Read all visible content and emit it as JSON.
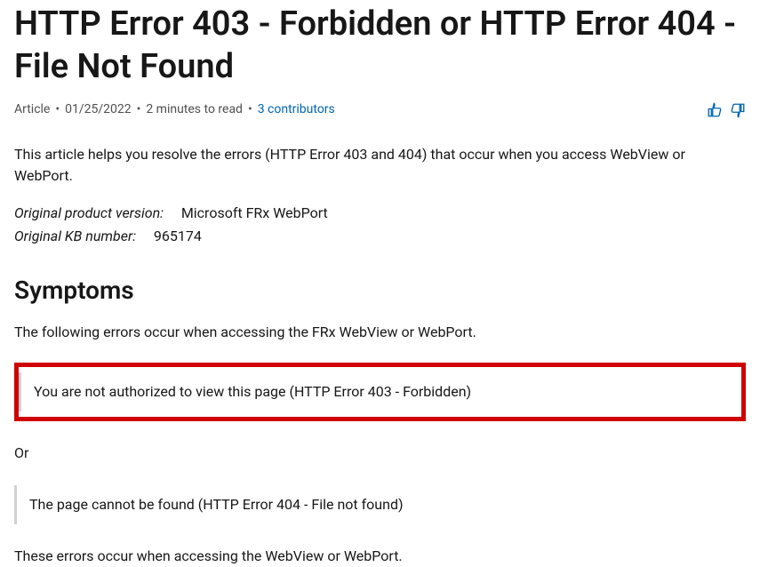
{
  "title": "HTTP Error 403 - Forbidden or HTTP Error 404 - File Not Found",
  "meta": {
    "type": "Article",
    "date": "01/25/2022",
    "reading_time": "2 minutes to read",
    "contributors": "3 contributors"
  },
  "intro": "This article helps you resolve the errors (HTTP Error 403 and 404) that occur when you access WebView or WebPort.",
  "kv": {
    "product_label": "Original product version:",
    "product_value": "Microsoft FRx WebPort",
    "kb_label": "Original KB number:",
    "kb_value": "965174"
  },
  "section": {
    "heading": "Symptoms",
    "intro": "The following errors occur when accessing the FRx WebView or WebPort.",
    "error1": "You are not authorized to view this page (HTTP Error 403 - Forbidden)",
    "or": "Or",
    "error2": "The page cannot be found (HTTP Error 404 - File not found)",
    "closing": "These errors occur when accessing the WebView or WebPort."
  }
}
